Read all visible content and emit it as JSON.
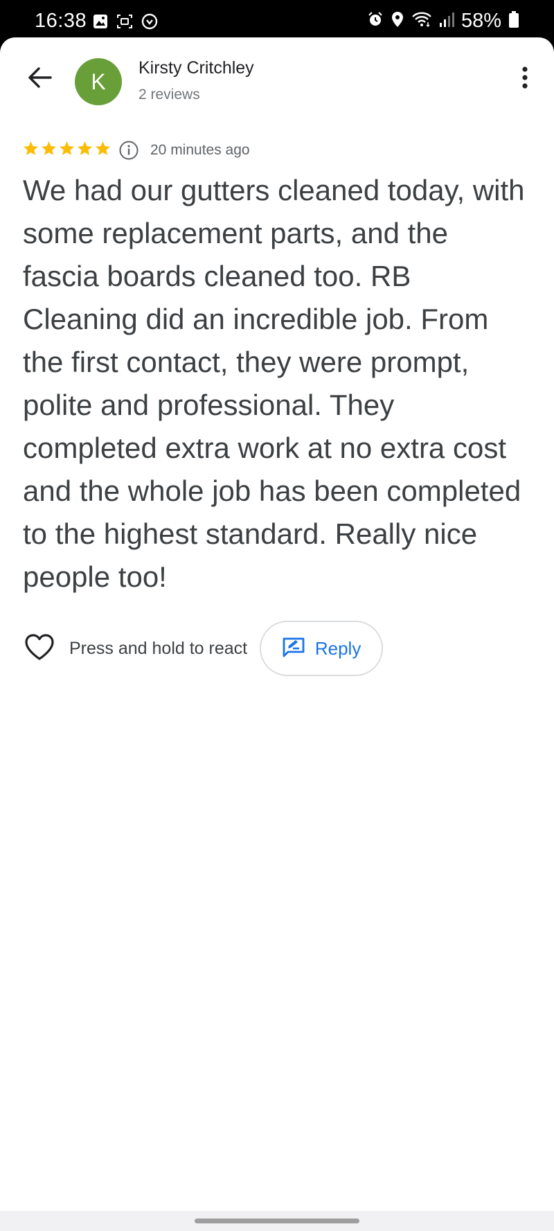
{
  "status_bar": {
    "time": "16:38",
    "battery": "58%",
    "left_icons": [
      "gallery-icon",
      "screen-capture-icon",
      "vpn-shield-icon"
    ],
    "right_icons": [
      "alarm-icon",
      "location-icon",
      "wifi-icon",
      "signal-icon",
      "battery-icon"
    ]
  },
  "header": {
    "back_icon": "arrow-left-icon",
    "avatar_initial": "K",
    "avatar_color": "#689f38",
    "reviewer_name": "Kirsty Critchley",
    "review_count": "2 reviews",
    "more_icon": "more-vert-icon"
  },
  "review": {
    "rating": 5,
    "max_rating": 5,
    "star_color": "#fbbc04",
    "time_ago": "20 minutes ago",
    "text": "We had our gutters cleaned today, with some replacement parts, and the fascia boards cleaned too. RB Cleaning did an incredible job. From the first contact, they were prompt, polite and professional. They completed extra work at no extra cost and the whole job has been completed to the highest standard. Really nice people too!"
  },
  "actions": {
    "react_label": "Press and hold to react",
    "reply_label": "Reply",
    "accent_color": "#1a73e8"
  }
}
